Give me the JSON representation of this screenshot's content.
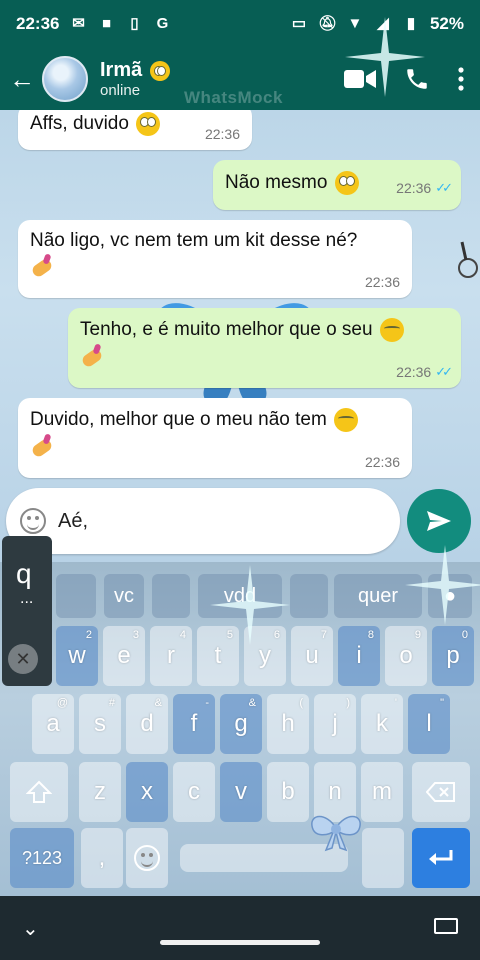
{
  "status": {
    "time": "22:36",
    "battery": "52%",
    "icons_left": [
      "message-icon",
      "video-icon",
      "phone-usage-icon",
      "google-icon"
    ],
    "icons_right": [
      "cast-icon",
      "mute-icon",
      "wifi-icon",
      "signal-icon",
      "battery-icon"
    ]
  },
  "header": {
    "name": "Irmã",
    "status": "online",
    "watermark": "WhatsMock"
  },
  "messages": [
    {
      "dir": "in",
      "text": "Affs, duvido",
      "emoji": "rolling-eyes",
      "time": "22:36"
    },
    {
      "dir": "out",
      "text": "Não mesmo",
      "emoji": "rolling-eyes",
      "time": "22:36",
      "read": true
    },
    {
      "dir": "in",
      "text": "Não ligo, vc nem tem um kit desse né?",
      "emoji": "nail-polish",
      "time": "22:36"
    },
    {
      "dir": "out",
      "text": "Tenho, e é muito melhor que o seu",
      "emoji": "relieved",
      "emoji2": "nail-polish",
      "time": "22:36",
      "read": true
    },
    {
      "dir": "in",
      "text": "Duvido, melhor que o meu não tem",
      "emoji": "relieved",
      "emoji2": "nail-polish",
      "time": "22:36"
    }
  ],
  "composer": {
    "text": "Aé,"
  },
  "keyboard": {
    "suggestions": [
      "vc",
      "vdd",
      "quer"
    ],
    "popup_letter": "q",
    "popup_more": "...",
    "row1": [
      {
        "k": "w",
        "s": "2"
      },
      {
        "k": "e",
        "s": "3"
      },
      {
        "k": "r",
        "s": "4"
      },
      {
        "k": "t",
        "s": "5"
      },
      {
        "k": "y",
        "s": "6"
      },
      {
        "k": "u",
        "s": "7"
      },
      {
        "k": "i",
        "s": "8"
      },
      {
        "k": "o",
        "s": "9"
      },
      {
        "k": "p",
        "s": "0"
      }
    ],
    "row2": [
      {
        "k": "a",
        "s": "@"
      },
      {
        "k": "s",
        "s": "#"
      },
      {
        "k": "d",
        "s": "&"
      },
      {
        "k": "f",
        "s": "-"
      },
      {
        "k": "g",
        "s": "&"
      },
      {
        "k": "h",
        "s": "("
      },
      {
        "k": "j",
        "s": ")"
      },
      {
        "k": "k",
        "s": "'"
      },
      {
        "k": "l",
        "s": "\""
      }
    ],
    "row3": [
      "z",
      "x",
      "c",
      "v",
      "b",
      "n",
      "m"
    ],
    "mode_label": "?123",
    "comma": ","
  },
  "colors": {
    "header": "#075e54",
    "outgoing": "#dcf8c6",
    "incoming": "#ffffff",
    "send": "#128c7e",
    "ticks": "#34b7f1"
  }
}
